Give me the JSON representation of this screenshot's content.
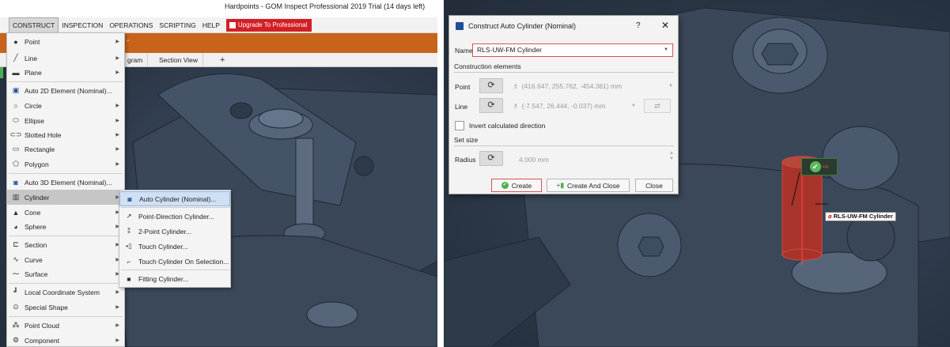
{
  "app": {
    "title": "Hardpoints - GOM Inspect Professional 2019 Trial (14 days left)"
  },
  "menubar": {
    "items": [
      "CONSTRUCT",
      "INSPECTION",
      "OPERATIONS",
      "SCRIPTING",
      "HELP"
    ],
    "upgrade_label": "Upgrade To Professional"
  },
  "tabs": [
    "gram",
    "Section View",
    "+"
  ],
  "construct_menu": {
    "items": [
      {
        "label": "Point",
        "icon": "point-icon",
        "submenu": true
      },
      {
        "label": "Line",
        "icon": "line-icon",
        "submenu": true
      },
      {
        "label": "Plane",
        "icon": "plane-icon",
        "submenu": true
      },
      {
        "label": "Auto 2D Element (Nominal)...",
        "icon": "auto-2d-icon",
        "submenu": false
      },
      {
        "label": "Circle",
        "icon": "circle-icon",
        "submenu": true
      },
      {
        "label": "Ellipse",
        "icon": "ellipse-icon",
        "submenu": true
      },
      {
        "label": "Slotted Hole",
        "icon": "slotted-hole-icon",
        "submenu": true
      },
      {
        "label": "Rectangle",
        "icon": "rectangle-icon",
        "submenu": true
      },
      {
        "label": "Polygon",
        "icon": "polygon-icon",
        "submenu": true
      },
      {
        "label": "Auto 3D Element (Nominal)...",
        "icon": "auto-3d-icon",
        "submenu": false
      },
      {
        "label": "Cylinder",
        "icon": "cylinder-icon",
        "submenu": true
      },
      {
        "label": "Cone",
        "icon": "cone-icon",
        "submenu": true
      },
      {
        "label": "Sphere",
        "icon": "sphere-icon",
        "submenu": true
      },
      {
        "label": "Section",
        "icon": "section-icon",
        "submenu": true
      },
      {
        "label": "Curve",
        "icon": "curve-icon",
        "submenu": true
      },
      {
        "label": "Surface",
        "icon": "surface-icon",
        "submenu": true
      },
      {
        "label": "Local Coordinate System",
        "icon": "coordinate-system-icon",
        "submenu": true
      },
      {
        "label": "Special Shape",
        "icon": "special-shape-icon",
        "submenu": true
      },
      {
        "label": "Point Cloud",
        "icon": "point-cloud-icon",
        "submenu": true
      },
      {
        "label": "Component",
        "icon": "component-icon",
        "submenu": true
      }
    ]
  },
  "cylinder_submenu": {
    "items": [
      {
        "label": "Auto Cylinder (Nominal)...",
        "icon": "auto-cylinder-icon"
      },
      {
        "label": "Point-Direction Cylinder...",
        "icon": "point-direction-cylinder-icon"
      },
      {
        "label": "2-Point Cylinder...",
        "icon": "two-point-cylinder-icon"
      },
      {
        "label": "Touch Cylinder...",
        "icon": "touch-cylinder-icon"
      },
      {
        "label": "Touch Cylinder On Selection...",
        "icon": "touch-selection-cylinder-icon"
      },
      {
        "label": "Fitting Cylinder...",
        "icon": "fitting-cylinder-icon"
      }
    ]
  },
  "dialog": {
    "title": "Construct Auto Cylinder (Nominal)",
    "help": "?",
    "close": "✕",
    "name_label": "Name",
    "name_value": "RLS-UW-FM Cylinder",
    "construction_elements": "Construction elements",
    "point_label": "Point",
    "point_value": "(416.647, 255.762, -454.361) mm",
    "line_label": "Line",
    "line_value": "(-7.547, 26.444, -0.037) mm",
    "invert_label": "Invert calculated direction",
    "set_size": "Set size",
    "radius_label": "Radius",
    "radius_value": "4.000 mm",
    "create": "Create",
    "create_and_close": "Create And Close",
    "close_button": "Close"
  },
  "viewport": {
    "cylinder_label": "RLS-UW-FM Cylinder"
  },
  "colors": {
    "accent_red": "#d21f26",
    "accent_orange": "#c8641a",
    "viewport": "#2f3c4d",
    "highlight_cylinder": "#c0392b"
  }
}
